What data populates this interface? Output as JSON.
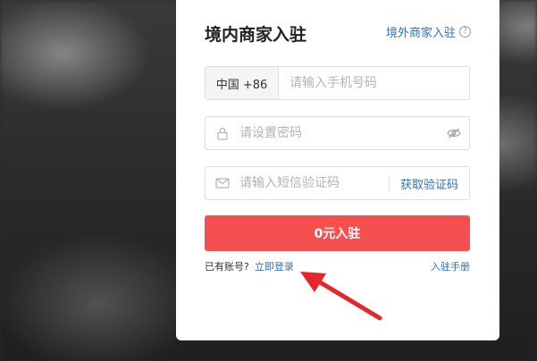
{
  "title": "境内商家入驻",
  "overseas_link": "境外商家入驻",
  "phone": {
    "country_code": "中国 +86",
    "placeholder": "请输入手机号码",
    "value": ""
  },
  "password": {
    "placeholder": "请设置密码",
    "value": ""
  },
  "sms": {
    "placeholder": "请输入短信验证码",
    "value": "",
    "get_code_label": "获取验证码"
  },
  "submit_label": "0元入驻",
  "footer": {
    "has_account": "已有账号?",
    "login_link": "立即登录",
    "manual_link": "入驻手册"
  },
  "icons": {
    "help": "question-circle-icon",
    "lock": "lock-icon",
    "eye": "eye-hidden-icon",
    "mail": "mail-icon",
    "arrow": "annotation-arrow"
  },
  "colors": {
    "accent": "#2e6fbd",
    "primary_button": "#f5504f",
    "annotation_arrow": "#e8262a"
  }
}
